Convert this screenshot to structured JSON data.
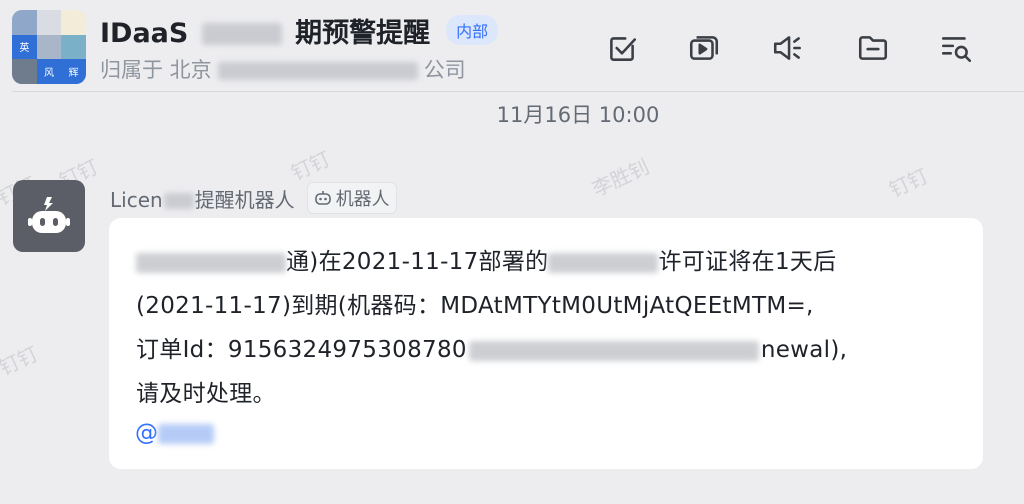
{
  "header": {
    "title_prefix": "IDaaS",
    "title_suffix": "期预警提醒",
    "badge": "内部",
    "subtitle_prefix": "归属于 北京",
    "subtitle_suffix": "公司",
    "avatar_labels": [
      "英",
      "风",
      "辉"
    ]
  },
  "toolbar": {
    "icons": [
      "task-check-icon",
      "video-meeting-icon",
      "announcement-icon",
      "folder-icon",
      "search-history-icon"
    ]
  },
  "timestamp": "11月16日 10:00",
  "watermark": "钉钉",
  "watermark_name": "李胜钊",
  "message": {
    "sender_suffix": "提醒机器人",
    "sender_prefix": "Licen",
    "robot_badge": "机器人",
    "line1_a": "通)在2021-11-17部署的",
    "line1_b": "许可证将在1天后",
    "line2": "(2021-11-17)到期(机器码：MDAtMTYtM0UtMjAtQEEtMTM=,",
    "line3": "订单Id：9156324975308780",
    "line3_end": "newal),",
    "line4": "请及时处理。",
    "mention": "@"
  },
  "colors": {
    "accent": "#3370ff",
    "background": "#ededf0",
    "bubble": "#ffffff",
    "bot_avatar": "#5b5e66"
  }
}
